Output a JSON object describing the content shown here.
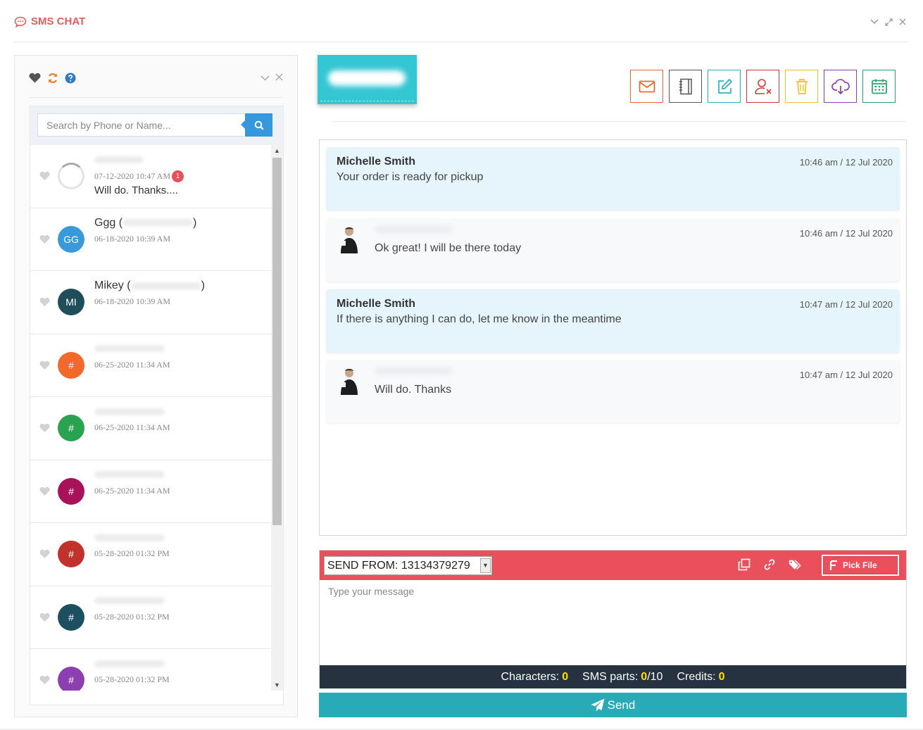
{
  "app": {
    "title": "SMS CHAT"
  },
  "search": {
    "placeholder": "Search by Phone or Name..."
  },
  "contacts": [
    {
      "name": "",
      "date": "07-12-2020 10:47 AM",
      "badge": "1",
      "preview": "Will do. Thanks....",
      "avatar": "",
      "avatar_color": "#ffffff"
    },
    {
      "name": "Ggg (",
      "date": "06-18-2020 10:39 AM",
      "avatar": "GG",
      "avatar_color": "#3a9ad9"
    },
    {
      "name": "Mikey (",
      "date": "06-18-2020 10:39 AM",
      "avatar": "MI",
      "avatar_color": "#1f4e5a"
    },
    {
      "name": "",
      "date": "06-25-2020 11:34 AM",
      "avatar": "#",
      "avatar_color": "#f26a2a"
    },
    {
      "name": "",
      "date": "06-25-2020 11:34 AM",
      "avatar": "#",
      "avatar_color": "#2aa350"
    },
    {
      "name": "",
      "date": "06-25-2020 11:34 AM",
      "avatar": "#",
      "avatar_color": "#a8125a"
    },
    {
      "name": "",
      "date": "05-28-2020 01:32 PM",
      "avatar": "#",
      "avatar_color": "#c2322c"
    },
    {
      "name": "",
      "date": "05-28-2020 01:32 PM",
      "avatar": "#",
      "avatar_color": "#1c5060"
    },
    {
      "name": "",
      "date": "05-28-2020 01:32 PM",
      "avatar": "#",
      "avatar_color": "#8c3fb0"
    }
  ],
  "actions": [
    {
      "name": "email-icon",
      "color": "#e8683c"
    },
    {
      "name": "notebook-icon",
      "color": "#555555"
    },
    {
      "name": "edit-icon",
      "color": "#2ab3c0"
    },
    {
      "name": "remove-user-icon",
      "color": "#d9383a"
    },
    {
      "name": "trash-icon",
      "color": "#f0c02a"
    },
    {
      "name": "cloud-download-icon",
      "color": "#8c3fb0"
    },
    {
      "name": "calendar-icon",
      "color": "#2aa370"
    }
  ],
  "messages": [
    {
      "type": "incoming",
      "sender": "Michelle Smith",
      "text": "Your order is ready for pickup",
      "time": "10:46 am / 12 Jul 2020"
    },
    {
      "type": "outgoing",
      "sender": "",
      "text": "Ok great! I will be there today",
      "time": "10:46 am / 12 Jul 2020"
    },
    {
      "type": "incoming",
      "sender": "Michelle Smith",
      "text": "If there is anything I can do, let me know in the meantime",
      "time": "10:47 am / 12 Jul 2020"
    },
    {
      "type": "outgoing",
      "sender": "",
      "text": "Will do. Thanks",
      "time": "10:47 am / 12 Jul 2020"
    }
  ],
  "composer": {
    "send_from": "SEND FROM: 13134379279",
    "pick_file": "Pick File",
    "placeholder": "Type your message",
    "characters_label": "Characters:",
    "characters": "0",
    "sms_parts_label": "SMS parts:",
    "sms_parts": "0",
    "sms_parts_max": "/10",
    "credits_label": "Credits:",
    "credits": "0",
    "send_label": "Send"
  }
}
